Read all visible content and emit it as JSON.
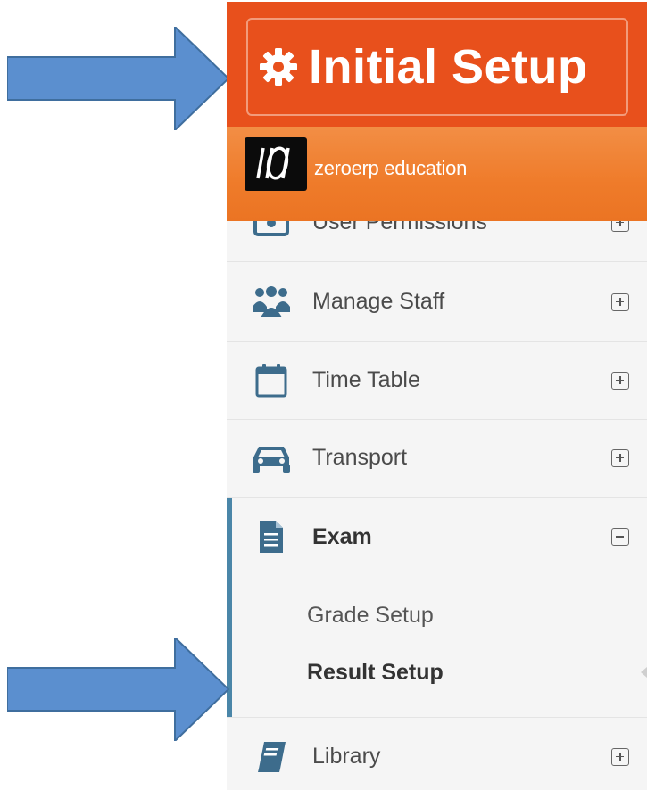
{
  "colors": {
    "setup_banner": "#e8501c",
    "brand_bar": "#ef7b2a",
    "arrow": "#5b8fcf",
    "sidebar_bg": "#f5f5f5",
    "active_accent": "#4a86a8",
    "icon_color": "#3d6c8c"
  },
  "setup": {
    "title": "Initial Setup",
    "icon": "gear-icon"
  },
  "brand": {
    "name": "zeroerp education"
  },
  "sidebar": {
    "items": [
      {
        "label": "User Permissions",
        "icon": "user-permissions-icon",
        "expanded": false
      },
      {
        "label": "Manage Staff",
        "icon": "staff-group-icon",
        "expanded": false
      },
      {
        "label": "Time Table",
        "icon": "calendar-icon",
        "expanded": false
      },
      {
        "label": "Transport",
        "icon": "car-icon",
        "expanded": false
      },
      {
        "label": "Exam",
        "icon": "document-icon",
        "expanded": true,
        "children": [
          {
            "label": "Grade Setup",
            "active": false
          },
          {
            "label": "Result Setup",
            "active": true
          }
        ]
      },
      {
        "label": "Library",
        "icon": "book-icon",
        "expanded": false
      }
    ]
  }
}
